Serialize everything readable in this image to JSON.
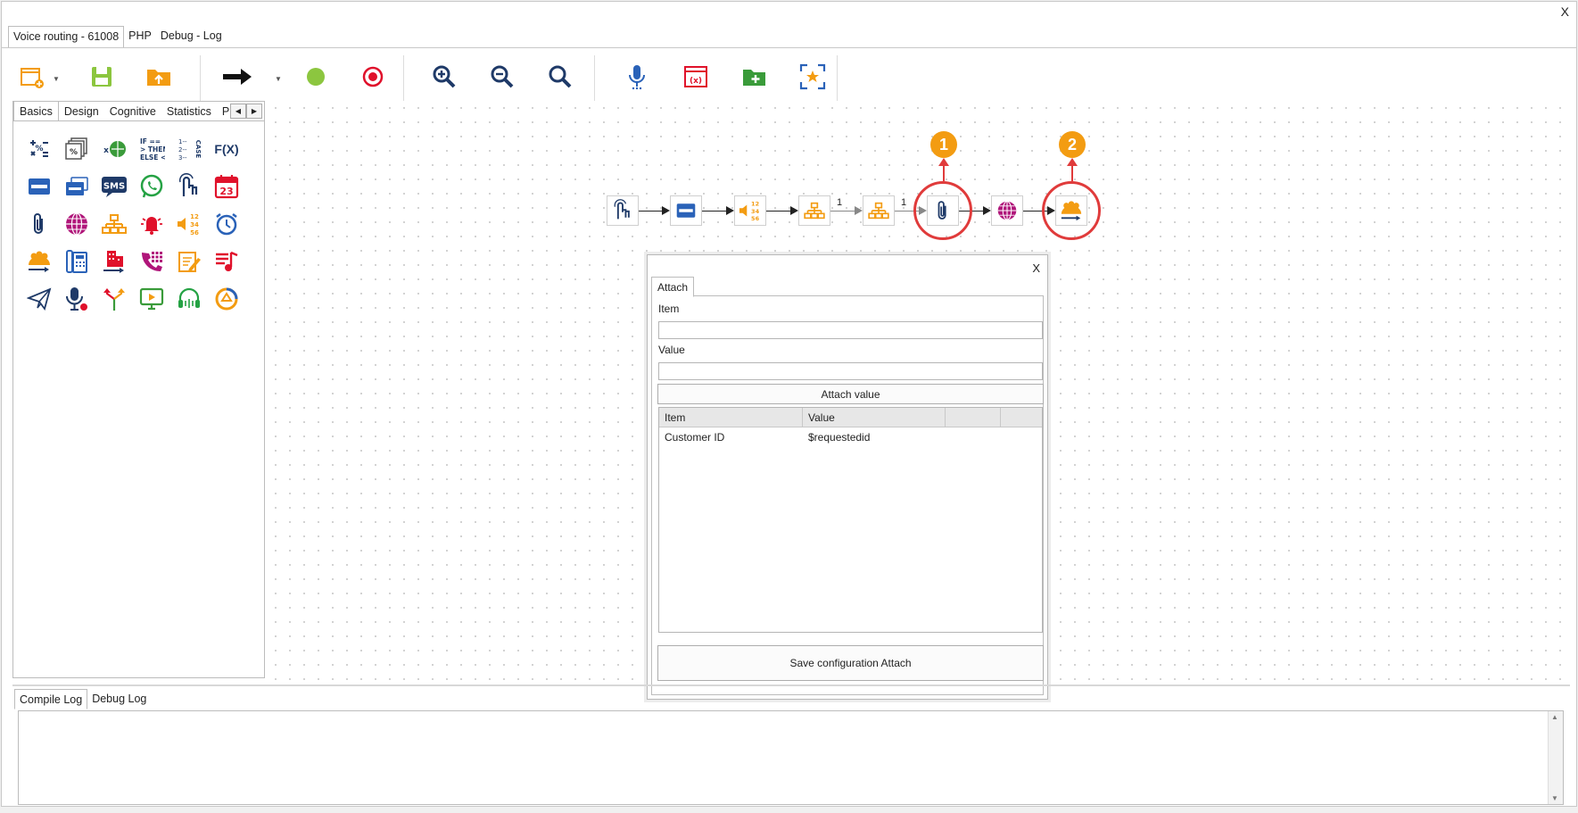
{
  "window": {
    "close_label": "X"
  },
  "tabs": [
    {
      "label": "Voice routing - 61008",
      "active": true
    },
    {
      "label": "PHP"
    },
    {
      "label": "Debug - Log"
    }
  ],
  "palette": {
    "tabs": [
      "Basics",
      "Design",
      "Cognitive",
      "Statistics",
      "P"
    ],
    "icon_labels": {
      "sms": "SMS",
      "fx": "F(X)",
      "calendar_day": "23",
      "if_text": [
        "IF ==",
        "> THEN",
        "ELSE <"
      ],
      "case_text": "CASE",
      "case_numbers": [
        "1--",
        "2--",
        "3--"
      ],
      "play_numbers": [
        "12",
        "34",
        "56"
      ]
    }
  },
  "flow": {
    "edge_labels": [
      "1",
      "1"
    ],
    "badges": [
      "1",
      "2"
    ]
  },
  "dialog": {
    "close_label": "X",
    "tab": "Attach",
    "item_label": "Item",
    "item_value": "",
    "value_label": "Value",
    "value_value": "",
    "attach_button": "Attach value",
    "table": {
      "columns": [
        "Item",
        "Value",
        ""
      ],
      "rows": [
        {
          "item": "Customer ID",
          "value": "$requestedid"
        }
      ]
    },
    "save_button": "Save configuration Attach"
  },
  "log": {
    "tabs": [
      "Compile Log",
      "Debug Log"
    ]
  },
  "colors": {
    "accent_orange": "#f39c12",
    "highlight_red": "#e03b3b",
    "navy": "#1f3a68",
    "green": "#8cc63f"
  }
}
